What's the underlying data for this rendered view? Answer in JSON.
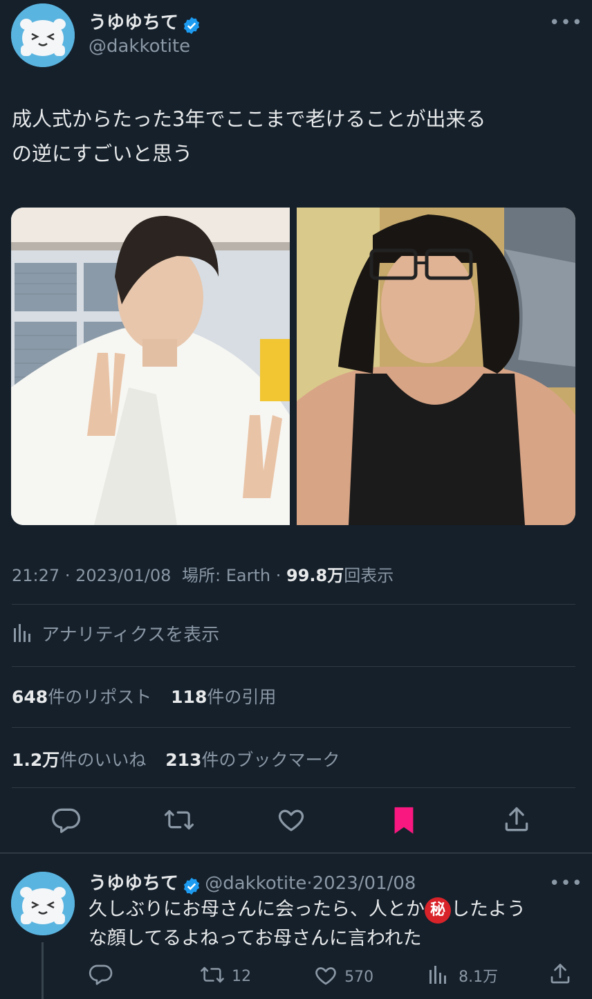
{
  "tweet": {
    "display_name": "うゆゆちて",
    "handle": "@dakkotite",
    "more": "•••",
    "text_line1": "成人式からたった3年でここまで老けることが出来る",
    "text_line2": "の逆にすごいと思う",
    "time": "21:27",
    "date": "2023/01/08",
    "location_label": "場所: Earth",
    "views_number": "99.8",
    "views_unit": "万",
    "views_suffix": "回表示",
    "analytics_label": "アナリティクスを表示",
    "reposts_count": "648",
    "reposts_label": "件のリポスト",
    "quotes_count": "118",
    "quotes_label": "件の引用",
    "likes_count": "1.2",
    "likes_unit": "万",
    "likes_label": "件のいいね",
    "bookmarks_count": "213",
    "bookmarks_label": "件のブックマーク"
  },
  "reply": {
    "display_name": "うゆゆちて",
    "handle": "@dakkotite",
    "dot": "·",
    "date": "2023/01/08",
    "more": "•••",
    "text_a": "久しぶりにお母さんに会ったら、人とか",
    "secret": "秘",
    "text_b": "したよう",
    "text_line2": "な顔してるよねってお母さんに言われた",
    "retweets": "12",
    "likes": "570",
    "views": "8.1万"
  },
  "colors": {
    "background": "#15202b",
    "accent": "#1d9bf0",
    "bookmark_active": "#f91880",
    "muted": "#8b98a5"
  },
  "icons": [
    "verified-badge-icon",
    "reply-icon",
    "retweet-icon",
    "like-icon",
    "bookmark-icon",
    "share-icon",
    "analytics-icon",
    "more-icon"
  ]
}
